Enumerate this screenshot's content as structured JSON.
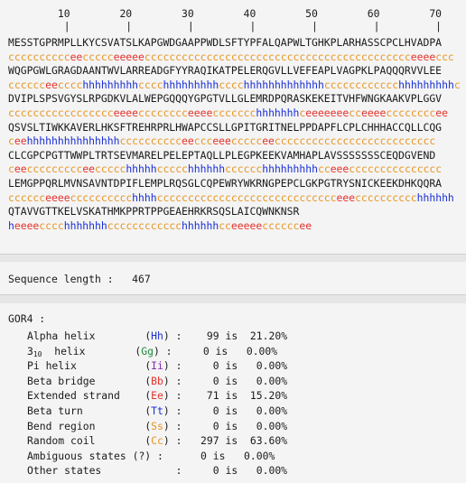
{
  "ruler": {
    "numbers": "        10        20        30        40        50        60        70",
    "ticks": "         |         |         |         |         |         |         |"
  },
  "sequence_rows": [
    {
      "seq": "MESSTGPRMPLLKYCSVATSLKAPGWDGAAPPWDLSFTYPFALQAPWLTGHKPLARHASSCPCLHVADPA",
      "pred": "cccccccccceeccccceeeeeccccccccccccccccccccccccccccccccccccccccccceeeeccc"
    },
    {
      "seq": "WQGPGWLGRAGDAANTWVLARREADGFYYRAQIKATPELERQGVLLVEFEAPLVAGPKLPAQQQRVVLEE",
      "pred": "cccccceecccchhhhhhhhhcccchhhhhhhhhcccchhhhhhhhhhhhhcccccccccccchhhhhhhhhc"
    },
    {
      "seq": "DVIPLSPSVGYSLRPGDKVLALWEPGQQQYGPGTVLLGLEMRDPQRASKEKEITVHFWNGKAAKVPLGGV",
      "pred": "ccccccccccccccccceeeecccccccceeeeccccccchhhhhhhceeeeeeecceeeeccccccccee"
    },
    {
      "seq": "QSVSLTIWKKAVERLHKSFTREHRPRLHWAPCCSLLGPITGRITNELPPDAPFLCPLCHHHACCQLLCQG",
      "pred": "ceehhhhhhhhhhhhhhhcccccccccceeccceeeccccceecccccccccccccccccccccccccc"
    },
    {
      "seq": "CLCGPCPGTTWWPLTRTSEVMARELPELEPTAQLLPLEGPKEEKVAMHAPLAVSSSSSSSCEQDGVEND",
      "pred": "ceeccccccccceeccccchhhhhccccchhhhhhcccccchhhhhhhhhcceeeccccccccccccccc"
    },
    {
      "seq": "LEMGPPQRLMVNSAVNTDPIFLEMPLRQSGLCQPEWRYWKRNGPEPCLGKPGTRYSNICKEEKDHKQQRA",
      "pred": "cccccceeeecccccccccchhhhccccccccccccccccccccccccccccceeecccccccccchhhhhh"
    },
    {
      "seq": "QTAVVGTTKELVSKATHMKPPRTPPGEAEHRKRSQSLAICQWNKNSR",
      "pred": "heeeecccchhhhhhhcccccccccccchhhhhhcceeeeeccccccee"
    }
  ],
  "sequence_length": {
    "label": "Sequence length :",
    "value": "467"
  },
  "gor4": {
    "title": "GOR4 :",
    "rows": [
      {
        "name": "Alpha helix",
        "code": "Hh",
        "count": "99",
        "is": "is",
        "percent": "21.20%"
      },
      {
        "name": "helix",
        "prefix": "3",
        "sub": "10",
        "code": "Gg",
        "count": "0",
        "is": "is",
        "percent": "0.00%"
      },
      {
        "name": "Pi helix",
        "code": "Ii",
        "count": "0",
        "is": "is",
        "percent": "0.00%"
      },
      {
        "name": "Beta bridge",
        "code": "Bb",
        "count": "0",
        "is": "is",
        "percent": "0.00%"
      },
      {
        "name": "Extended strand",
        "code": "Ee",
        "count": "71",
        "is": "is",
        "percent": "15.20%"
      },
      {
        "name": "Beta turn",
        "code": "Tt",
        "count": "0",
        "is": "is",
        "percent": "0.00%"
      },
      {
        "name": "Bend region",
        "code": "Ss",
        "count": "0",
        "is": "is",
        "percent": "0.00%"
      },
      {
        "name": "Random coil",
        "code": "Cc",
        "count": "297",
        "is": "is",
        "percent": "63.60%"
      },
      {
        "name": "Ambiguous states (?)",
        "count": "0",
        "is": "is",
        "percent": "0.00%"
      },
      {
        "name": "Other states",
        "count": "0",
        "is": "is",
        "percent": "0.00%"
      }
    ]
  },
  "colors": {
    "helix": "#1a2fd4",
    "strand": "#e4322b",
    "coil": "#e8941e",
    "Gg": "#1e8c3a",
    "Ii": "#8a2bb0"
  }
}
